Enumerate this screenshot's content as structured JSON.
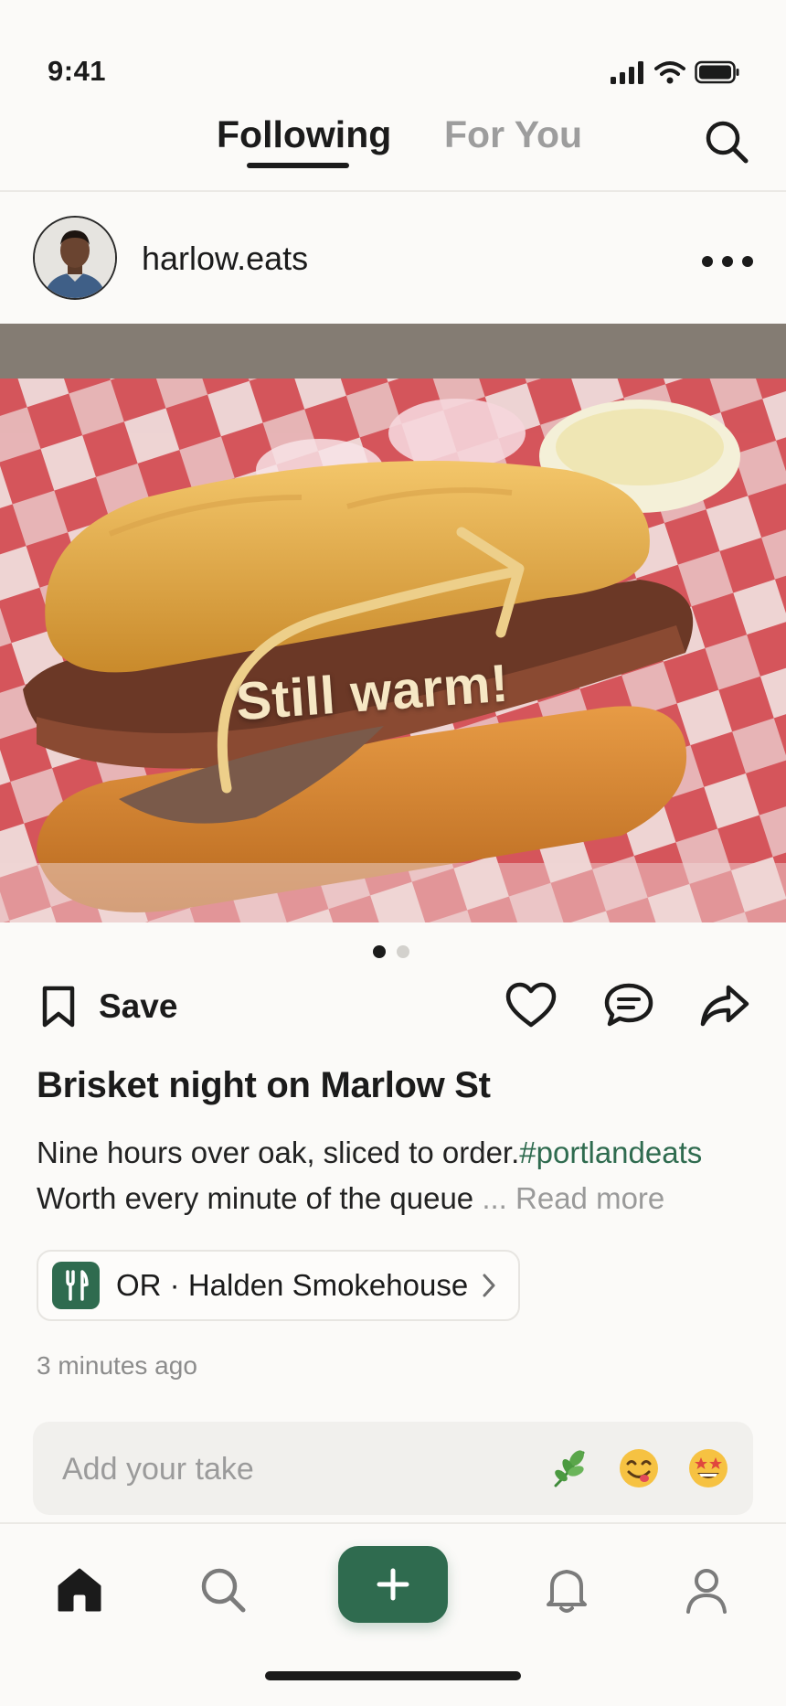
{
  "status": {
    "time": "9:41"
  },
  "header": {
    "tabs": [
      {
        "label": "Following",
        "active": true
      },
      {
        "label": "For You",
        "active": false
      }
    ]
  },
  "post": {
    "username": "harlow.eats",
    "photo_sticker": "Still warm!",
    "pager": {
      "count": 2,
      "active_index": 0
    },
    "save_label": "Save",
    "title": "Brisket night on Marlow St",
    "caption_line1": "Nine hours over oak, sliced to order.",
    "hashtag": "#portlandeats",
    "caption_line2": "Worth every minute of the queue",
    "read_more": " ... Read more",
    "place": "OR · Halden Smokehouse",
    "timestamp": "3 minutes ago"
  },
  "comment_bar": {
    "placeholder": "Add your take",
    "quick_reactions": [
      "herb-icon",
      "yum-face-icon",
      "star-struck-icon"
    ]
  },
  "nav": {
    "items": [
      "home-icon",
      "search-icon",
      "compose-button",
      "bell-icon",
      "profile-icon"
    ],
    "active": "home"
  },
  "colors": {
    "accent": "#2f6b4f",
    "text": "#1b1b1b",
    "muted": "#9b9b9b",
    "background": "#fbfaf8"
  }
}
